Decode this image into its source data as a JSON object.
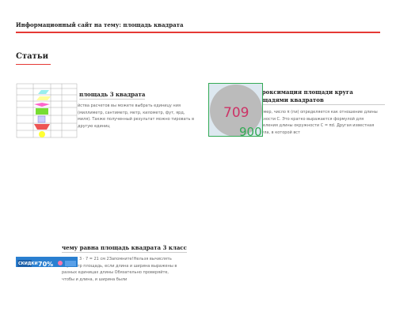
{
  "header": {
    "site_title": "Информационный сайт на тему: площадь квадрата"
  },
  "section": {
    "title": "Статьи"
  },
  "articles": [
    {
      "title": "площадь 3 квадрата",
      "excerpt": "йства расчетов вы можете выбрать единицу ния (миллиметр, сантиметр, метр, километр, фут, ярд, миля). Также полученный результат можно тировать в другую единиц",
      "image": "shapes-area-formula-table"
    },
    {
      "title": "аппроксимация площади круга площадями квадратов",
      "excerpt": "Например, число π (пи) определяется как отношение длины окружности C. Это кратко выражается формулой для определения длины окружности C = πd. Другая известная формула, в которой вст",
      "image": "circle-in-square-dots",
      "image_labels": [
        "709",
        "900"
      ]
    },
    {
      "title": "чему равна площадь квадрата 3 класс",
      "excerpt": "3 · 7 = 21 см 2Запомните!Нельзя вычислять периметр площадь, если длина и ширина выражены в разных единицах длины Обязательно проверяйте, чтобы и длина, и ширина были",
      "image": "promo-banner",
      "image_labels": [
        "СКИДКИ",
        "70%"
      ]
    }
  ],
  "colors": {
    "accent": "#e53935",
    "text": "#222222",
    "muted": "#666666"
  }
}
